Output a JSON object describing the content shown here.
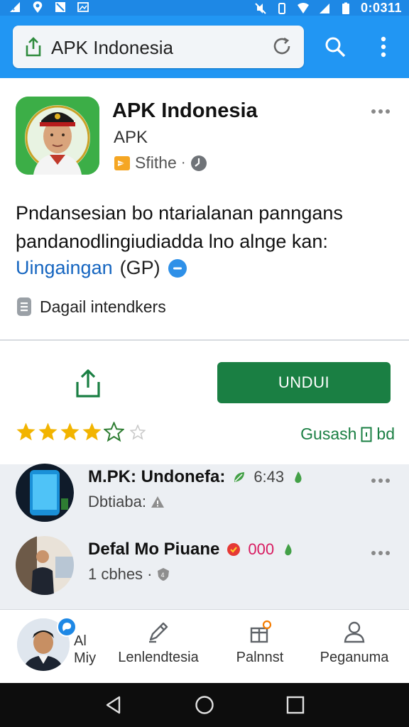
{
  "status_bar": {
    "time": "0:0311",
    "icons": [
      "signal-icon",
      "location-icon",
      "notification-icon",
      "image-icon",
      "mute-icon",
      "vibrate-icon",
      "wifi-icon",
      "cell-signal-icon",
      "battery-icon"
    ]
  },
  "app_bar": {
    "url_text": "APK Indonesia",
    "icons": [
      "share-icon",
      "reload-icon",
      "search-icon",
      "more-vert-icon"
    ]
  },
  "app": {
    "name": "APK Indonesia",
    "subtitle": "APK",
    "publisher": "Sfithe",
    "publisher_separator": "·",
    "description": "Pndansesian bo ntarialanan panngans þandanodlingiudiadda lno alnge kan:",
    "link_text": "Uingaingan",
    "link_paren": "(GP)",
    "detail_text": "Dagail intendkers"
  },
  "actions": {
    "download_label": "UNDUI",
    "rating_value": 4,
    "rating_max": 6,
    "rating_right_text_1": "Gusash",
    "rating_right_text_2": "bd"
  },
  "list": {
    "items": [
      {
        "title": "M.PK: Undonefa:",
        "meta": "6:43",
        "subtitle": "Dbtiaba:"
      },
      {
        "title": "Defal Mo Piuane",
        "meta": "000",
        "subtitle": "1 cbhes",
        "separator": "·"
      }
    ]
  },
  "bottom_nav": {
    "profile_label_1": "Al",
    "profile_label_2": "Miy",
    "items": [
      {
        "label": "Lenlendtesia",
        "icon": "edit-pen-icon"
      },
      {
        "label": "Palnnst",
        "icon": "gift-icon"
      },
      {
        "label": "Peganuma",
        "icon": "person-icon"
      }
    ]
  },
  "colors": {
    "primary_blue": "#2196f3",
    "download_green": "#1a7f43",
    "star_yellow": "#f2b400",
    "link_blue": "#1565c0"
  }
}
